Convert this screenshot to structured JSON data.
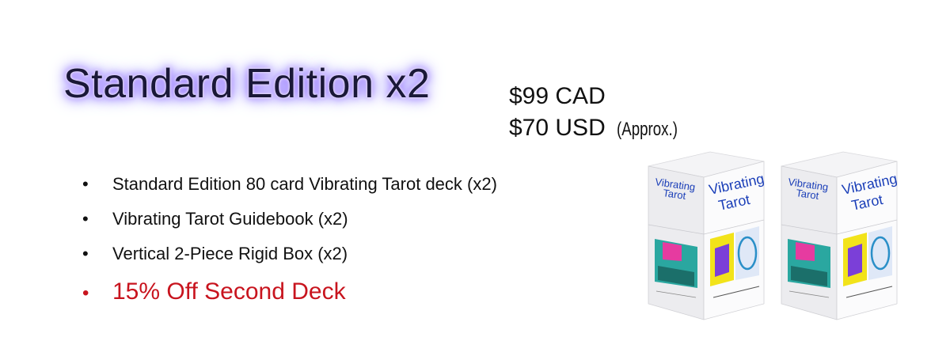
{
  "title": "Standard Edition x2",
  "pricing": {
    "cad": "$99 CAD",
    "usd": "$70 USD",
    "approx": "(Approx.)"
  },
  "features": [
    "Standard Edition 80 card Vibrating Tarot deck (x2)",
    "Vibrating Tarot Guidebook (x2)",
    "Vertical 2-Piece Rigid Box (x2)"
  ],
  "highlight": "15% Off Second Deck",
  "bullet": "•",
  "product": {
    "name_line1": "Vibrating",
    "name_line2": "Tarot",
    "accent_colors": [
      "#1b3fb8",
      "#e63ba0",
      "#f2e31a",
      "#7b3fd8",
      "#2aa7a0"
    ]
  },
  "colors": {
    "title_text": "#1a1838",
    "title_glow": "#8a5cff",
    "highlight": "#c8141e"
  }
}
